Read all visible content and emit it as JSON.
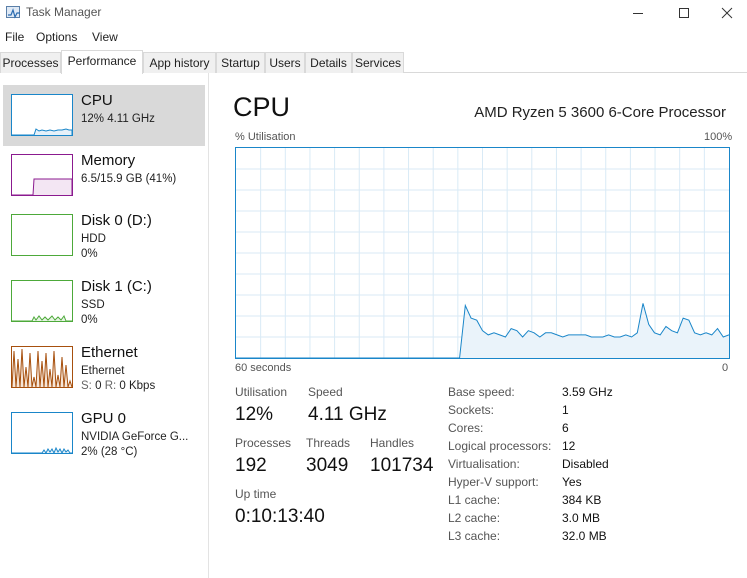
{
  "window": {
    "title": "Task Manager",
    "icon": "task-manager-icon",
    "buttons": [
      "minimize-icon",
      "maximize-icon",
      "close-icon"
    ]
  },
  "menu": [
    "File",
    "Options",
    "View"
  ],
  "tabs": [
    "Processes",
    "Performance",
    "App history",
    "Startup",
    "Users",
    "Details",
    "Services"
  ],
  "active_tab": "Performance",
  "sidebar": [
    {
      "name": "CPU",
      "line1": "12% 4.11 GHz",
      "color": "#1a86c9",
      "selected": true
    },
    {
      "name": "Memory",
      "line1": "6.5/15.9 GB (41%)",
      "color": "#8b1a8f"
    },
    {
      "name": "Disk 0 (D:)",
      "line1": "HDD",
      "line2": "0%",
      "color": "#4da93a"
    },
    {
      "name": "Disk 1 (C:)",
      "line1": "SSD",
      "line2": "0%",
      "color": "#4da93a"
    },
    {
      "name": "Ethernet",
      "line1": "Ethernet",
      "line2_s": "S:",
      "line2_s_val": "0",
      "line2_r": "R:",
      "line2_r_val": "0 Kbps",
      "color": "#a7500e"
    },
    {
      "name": "GPU 0",
      "line1": "NVIDIA GeForce G...",
      "line2": "2% (28 °C)",
      "color": "#1a86c9"
    }
  ],
  "main": {
    "title": "CPU",
    "processor": "AMD Ryzen 5 3600 6-Core Processor",
    "graph_ylabel": "% Utilisation",
    "graph_ymax": "100%",
    "graph_xleft": "60 seconds",
    "graph_xright": "0",
    "stats": {
      "utilisation_label": "Utilisation",
      "utilisation": "12%",
      "speed_label": "Speed",
      "speed": "4.11 GHz",
      "processes_label": "Processes",
      "processes": "192",
      "threads_label": "Threads",
      "threads": "3049",
      "handles_label": "Handles",
      "handles": "101734",
      "uptime_label": "Up time",
      "uptime": "0:10:13:40"
    },
    "specs": [
      {
        "label": "Base speed:",
        "value": "3.59 GHz"
      },
      {
        "label": "Sockets:",
        "value": "1"
      },
      {
        "label": "Cores:",
        "value": "6"
      },
      {
        "label": "Logical processors:",
        "value": "12"
      },
      {
        "label": "Virtualisation:",
        "value": "Disabled"
      },
      {
        "label": "Hyper-V support:",
        "value": "Yes"
      },
      {
        "label": "L1 cache:",
        "value": "384 KB"
      },
      {
        "label": "L2 cache:",
        "value": "3.0 MB"
      },
      {
        "label": "L3 cache:",
        "value": "32.0 MB"
      }
    ]
  },
  "chart_data": {
    "type": "area",
    "x_range": [
      60,
      0
    ],
    "ylim": [
      0,
      100
    ],
    "grid": true,
    "color": "#1a86c9",
    "series": [
      {
        "values": [
          0,
          0,
          0,
          0,
          0,
          0,
          0,
          0,
          0,
          0,
          0,
          0,
          0,
          0,
          0,
          0,
          0,
          0,
          0,
          0,
          0,
          0,
          0,
          0,
          0,
          0,
          0,
          0,
          0,
          0,
          0,
          0,
          0,
          0,
          0,
          0,
          0,
          0,
          0,
          0,
          0,
          0,
          0,
          0,
          0,
          0,
          0,
          0,
          0,
          0,
          0,
          0,
          0,
          0,
          0,
          0,
          0,
          0,
          0,
          0,
          0
        ]
      }
    ],
    "cpu_values": [
      0,
      0,
      0,
      0,
      0,
      0,
      0,
      0,
      0,
      0,
      0,
      0,
      0,
      0,
      0,
      0,
      0,
      0,
      0,
      0,
      0,
      0,
      0,
      0,
      0,
      0,
      0,
      0,
      0,
      0,
      0,
      0,
      0,
      0,
      0,
      0,
      0,
      0,
      0,
      0,
      25,
      19,
      18,
      13,
      11,
      12,
      11,
      10,
      14,
      13,
      10,
      13,
      12,
      10,
      12,
      12,
      11,
      10,
      11,
      11,
      11,
      11,
      10,
      10,
      10,
      11,
      10,
      10,
      11,
      10,
      12,
      26,
      16,
      12,
      11,
      15,
      13,
      12,
      19,
      18,
      12,
      11,
      12,
      11,
      14,
      10,
      11
    ]
  }
}
